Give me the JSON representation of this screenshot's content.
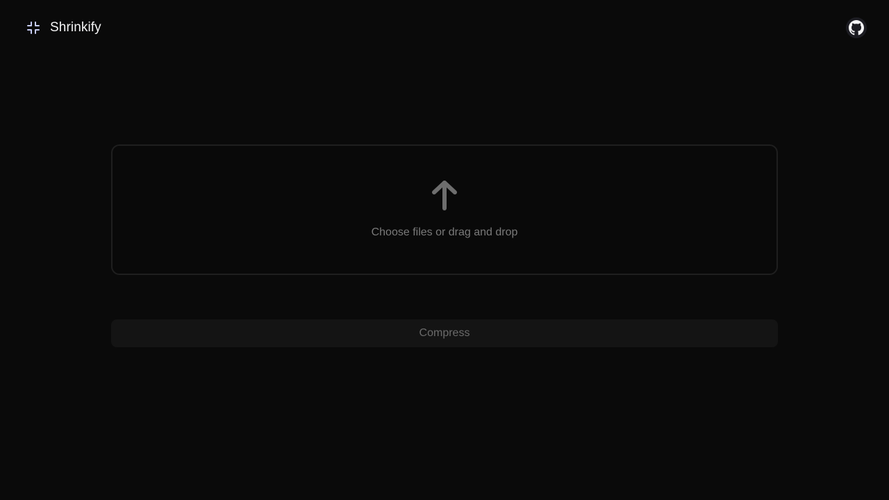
{
  "app": {
    "name": "Shrinkify",
    "logo_icon": "shrink-arrows-icon"
  },
  "header": {
    "github_icon": "github-icon"
  },
  "dropzone": {
    "icon": "arrow-up-icon",
    "text": "Choose files or drag and drop"
  },
  "actions": {
    "compress_label": "Compress",
    "compress_disabled": true
  },
  "colors": {
    "background": "#0a0a0a",
    "logo_accent": "#c7cdf5",
    "text_primary": "#f4f4f5",
    "text_muted": "#7a7a7a",
    "upload_icon": "#6e6e6e",
    "border": "#1f1f1f",
    "button_bg": "#141414",
    "github_bg": "#1c1c22"
  }
}
